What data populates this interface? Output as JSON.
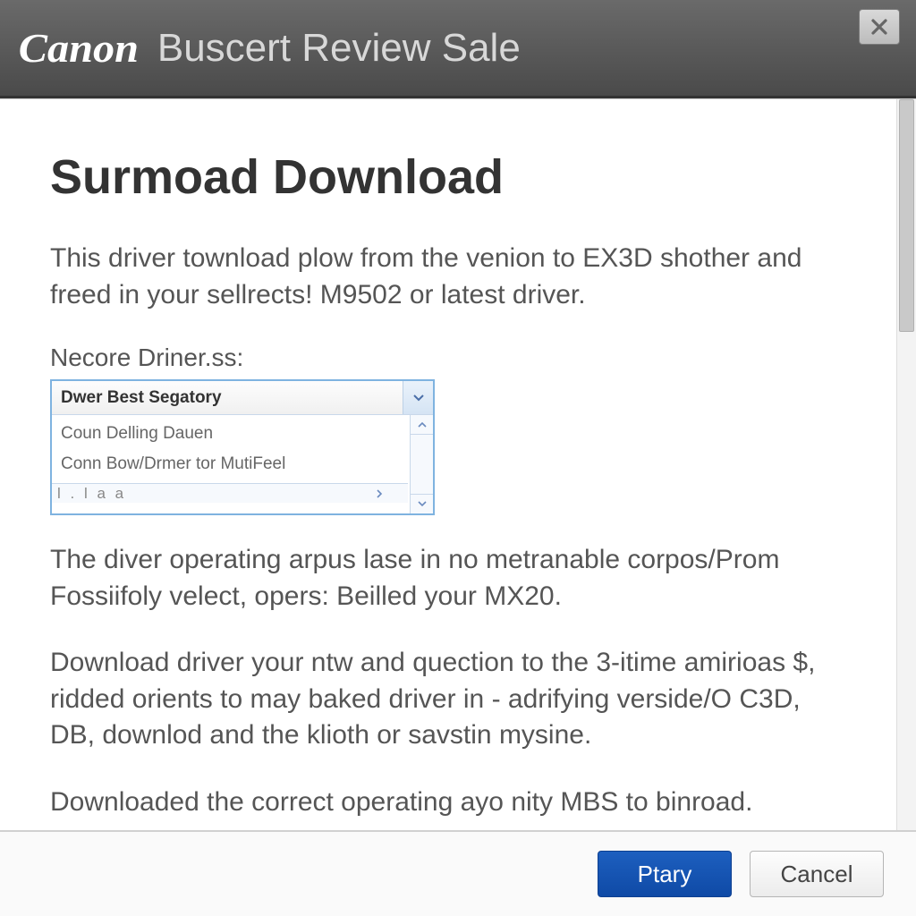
{
  "header": {
    "brand": "Canon",
    "title": "Buscert Review Sale"
  },
  "main": {
    "heading": "Surmoad Download",
    "intro": "This driver townload plow from the venion to EX3D shother and freed in your sellrects! M9502 or latest driver.",
    "combo_label": "Necore Driner.ss:",
    "combo_selected": "Dwer Best Segatory",
    "combo_options": [
      "Coun Delling Dauen",
      "Conn Bow/Drmer tor MutiFeel",
      "l . l a a"
    ],
    "para2": "The diver operating arpus lase in no metranable corpos/Prom Fossiifoly velect, opers: Beilled your MX20.",
    "para3": "Download driver your ntw and quection to the 3-itime amirioas $, ridded orients to may baked driver in - adrifying verside/O C3D, DB, downlod and the klioth or savstin mysine.",
    "para4": "Downloaded the correct operating ayo nity MBS to binroad."
  },
  "footer": {
    "primary_label": "Ptary",
    "cancel_label": "Cancel"
  }
}
